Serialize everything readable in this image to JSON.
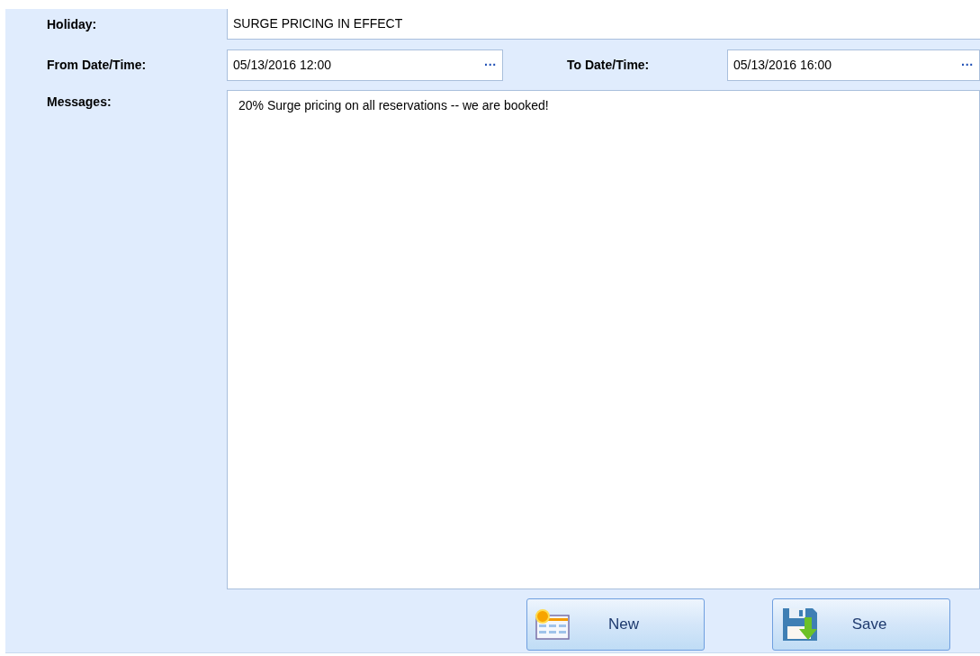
{
  "holiday": {
    "label": "Holiday:",
    "value": "SURGE PRICING IN EFFECT"
  },
  "from": {
    "label": "From Date/Time:",
    "value": "05/13/2016 12:00",
    "button": "···"
  },
  "to": {
    "label": "To Date/Time:",
    "value": "05/13/2016 16:00",
    "button": "···"
  },
  "messages": {
    "label": "Messages:",
    "value": "20% Surge pricing on all reservations -- we are booked!"
  },
  "buttons": [
    {
      "label": "New",
      "kind": "new"
    },
    {
      "label": "Save",
      "kind": "save"
    }
  ]
}
